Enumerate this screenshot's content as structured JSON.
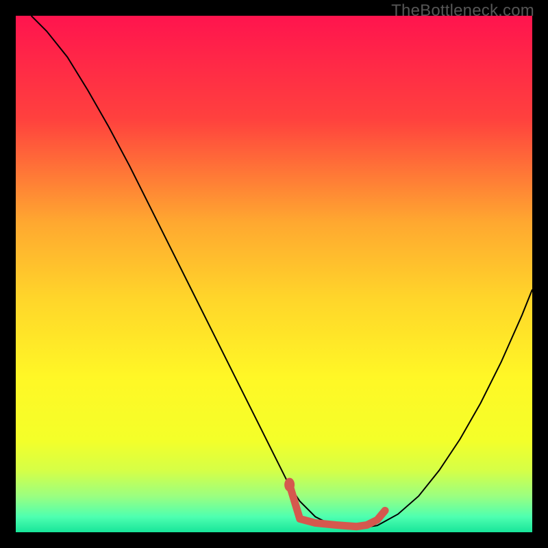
{
  "watermark": "TheBottleneck.com",
  "chart_data": {
    "type": "line",
    "title": "",
    "xlabel": "",
    "ylabel": "",
    "xlim": [
      0,
      100
    ],
    "ylim": [
      0,
      100
    ],
    "background_gradient": {
      "stops": [
        {
          "offset": 0.0,
          "color": "#ff144e"
        },
        {
          "offset": 0.2,
          "color": "#ff413e"
        },
        {
          "offset": 0.4,
          "color": "#ffa830"
        },
        {
          "offset": 0.55,
          "color": "#ffd62a"
        },
        {
          "offset": 0.7,
          "color": "#fff726"
        },
        {
          "offset": 0.82,
          "color": "#f4ff29"
        },
        {
          "offset": 0.88,
          "color": "#d6ff46"
        },
        {
          "offset": 0.93,
          "color": "#9bff80"
        },
        {
          "offset": 0.97,
          "color": "#4effb0"
        },
        {
          "offset": 1.0,
          "color": "#18e59a"
        }
      ]
    },
    "series": [
      {
        "name": "bottleneck-curve",
        "color": "#000000",
        "width": 2,
        "x": [
          3,
          6,
          10,
          14,
          18,
          22,
          26,
          30,
          34,
          38,
          42,
          46,
          50,
          53,
          55,
          58,
          62,
          66,
          70,
          74,
          78,
          82,
          86,
          90,
          94,
          98,
          100
        ],
        "y": [
          100,
          97,
          92,
          85.5,
          78.5,
          71,
          63,
          55,
          47,
          39,
          31,
          23,
          15,
          9,
          6,
          3,
          1,
          0.7,
          1.3,
          3.5,
          7,
          12,
          18,
          25,
          33,
          42,
          47
        ]
      },
      {
        "name": "highlight-segment",
        "color": "#d5584e",
        "width": 11,
        "linecap": "round",
        "x": [
          53,
          55,
          58,
          62,
          66,
          68,
          70,
          71.5
        ],
        "y": [
          9.2,
          2.6,
          1.8,
          1.4,
          1.1,
          1.4,
          2.4,
          4.2
        ]
      }
    ],
    "markers": [
      {
        "name": "highlight-dot",
        "x": 53,
        "y": 9.2,
        "r": 7.5,
        "color": "#d5584e"
      }
    ]
  }
}
